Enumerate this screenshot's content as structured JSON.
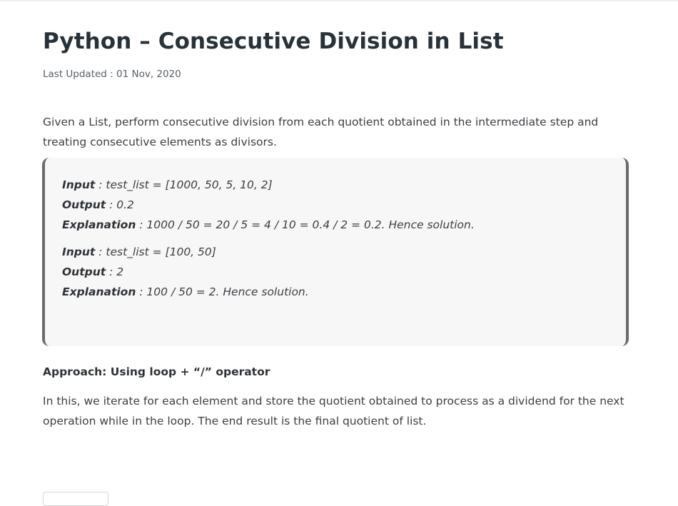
{
  "article": {
    "title": "Python – Consecutive Division in List",
    "last_updated": "Last Updated : 01 Nov, 2020",
    "intro": "Given a List, perform consecutive division from each quotient obtained in the intermediate step and treating consecutive elements as divisors.",
    "examples": [
      {
        "input_key": "Input",
        "input_value": " : test_list = [1000, 50, 5, 10, 2]",
        "output_key": "Output",
        "output_value": " : 0.2",
        "explanation_key": "Explanation",
        "explanation_value": " : 1000 / 50 = 20 / 5 = 4 / 10 = 0.4 / 2 = 0.2. Hence solution."
      },
      {
        "input_key": "Input",
        "input_value": " : test_list = [100, 50]",
        "output_key": "Output",
        "output_value": " : 2",
        "explanation_key": "Explanation",
        "explanation_value": " : 100 / 50 = 2. Hence solution."
      }
    ],
    "approach_heading": "Approach: Using loop + “/” operator",
    "approach_text": "In this, we iterate for each element and store the quotient obtained to process as a dividend for the next operation while in the loop. The end result is the final quotient of list."
  },
  "colors": {
    "title": "#273239",
    "body_text": "#3b3f44",
    "example_bg": "#f7f7f7",
    "example_border": "#6b6b6b"
  }
}
